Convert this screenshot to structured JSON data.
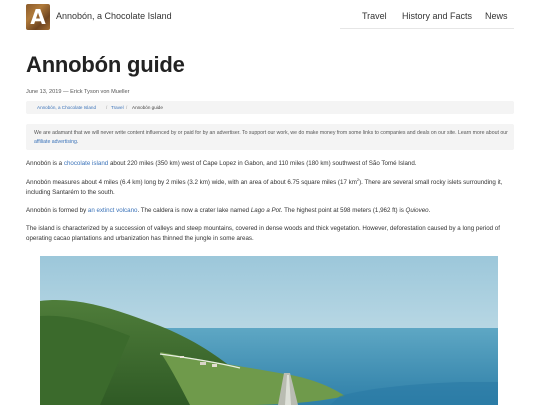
{
  "header": {
    "logo_letter": "A",
    "site_title": "Annobón, a Chocolate Island",
    "nav": [
      "Travel",
      "History and Facts",
      "News"
    ]
  },
  "article": {
    "title": "Annobón guide",
    "byline": "June 13, 2019 — Erick Tyson von Mueller",
    "breadcrumb": [
      "Annobón, a Chocolate Island",
      "Travel",
      "Annobón guide"
    ],
    "breadcrumb_sep": "/",
    "notice": {
      "text": "We are adamant that we will never write content influenced by or paid for by an advertiser. To support our work, we do make money from some links to companies and deals on our site. Learn more about our ",
      "link": "affiliate advertising",
      "end": "."
    },
    "p1": {
      "a": "Annobón is a ",
      "link": "chocolate island",
      "b": " about 220 miles (350 km) west of Cape Lopez in Gabon, and 110 miles (180 km) southwest of São Tomé Island."
    },
    "p2": {
      "a": "Annobón measures about 4 miles (6.4 km) long by 2 miles (3.2 km) wide, with an area of about 6.75 square miles (17 km",
      "sup": "2",
      "b": "). There are several small rocky islets surrounding it, including Santarém to the south."
    },
    "p3": {
      "a": "Annobón is formed by ",
      "link": "an extinct volcano",
      "b": ". The caldera is now a crater lake named ",
      "em1": "Lago a Pot",
      "c": ". The highest point at 598 meters (1,962 ft) is ",
      "em2": "Quioveo",
      "d": "."
    },
    "p4": "The island is characterized by a succession of valleys and steep mountains, covered in dense woods and thick vegetation. However, deforestation caused by a long period of operating cacao plantations and urbanization has thinned the jungle in some areas."
  },
  "colors": {
    "link": "#3b73b9",
    "notice_bg": "#f4f4f4",
    "sea": "#3d8fb4",
    "sky": "#c5dfe9"
  }
}
